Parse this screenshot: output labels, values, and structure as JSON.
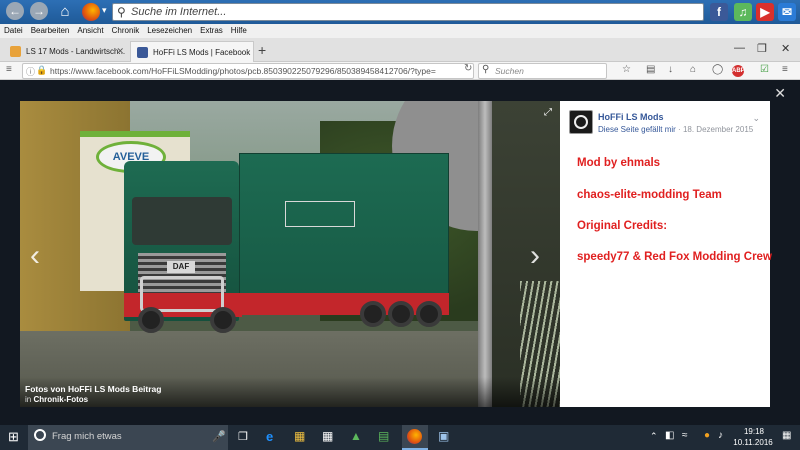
{
  "browser": {
    "search_placeholder": "Suche im Internet...",
    "menu": [
      "Datei",
      "Bearbeiten",
      "Ansicht",
      "Chronik",
      "Lesezeichen",
      "Extras",
      "Hilfe"
    ],
    "tabs": [
      {
        "label": "LS 17 Mods - Landwirtsch...",
        "active": false
      },
      {
        "label": "HoFFi LS Mods | Facebook",
        "active": true
      }
    ],
    "url": "https://www.facebook.com/HoFFiLSModding/photos/pcb.850390225079296/850389458412706/?type=",
    "search_field_placeholder": "Suchen",
    "adblock_label": "ABP",
    "right_icons": [
      "facebook-icon",
      "music-icon",
      "youtube-icon",
      "mail-icon"
    ]
  },
  "photo": {
    "sign_text": "AVEVE",
    "grille_text": "DAF",
    "caption_title": "Fotos von HoFFi LS Mods Beitrag",
    "caption_prefix": "in",
    "caption_album": "Chronik-Fotos"
  },
  "post": {
    "page_name": "HoFFi LS Mods",
    "liked_text": "Diese Seite gefällt mir",
    "separator": "·",
    "date": "18. Dezember 2015",
    "lines": [
      "Mod by ehmals",
      "chaos-elite-modding Team",
      "Original Credits:",
      "speedy77 & Red Fox Modding Crew"
    ]
  },
  "taskbar": {
    "search_placeholder": "Frag mich etwas",
    "time": "19:18",
    "date": "10.11.2016"
  },
  "colors": {
    "accent_red": "#e02020",
    "facebook_blue": "#365899",
    "taskbar": "#1f2a36"
  }
}
